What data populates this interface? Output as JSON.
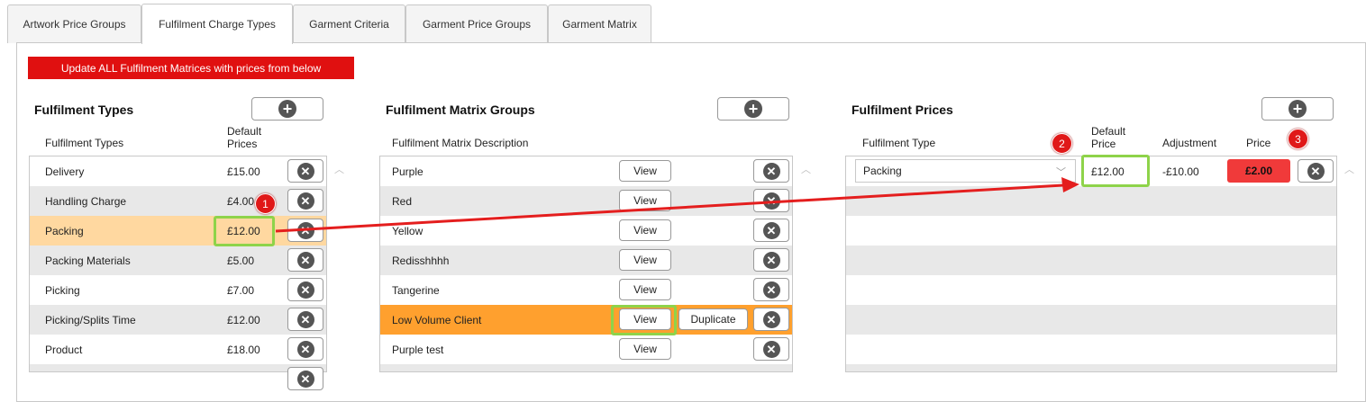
{
  "tabs": [
    {
      "label": "Artwork Price Groups"
    },
    {
      "label": "Fulfilment Charge Types"
    },
    {
      "label": "Garment Criteria"
    },
    {
      "label": "Garment Price Groups"
    },
    {
      "label": "Garment Matrix"
    }
  ],
  "update_all_label": "Update ALL Fulfilment Matrices with prices from below",
  "fulfilment_types": {
    "title": "Fulfilment Types",
    "col_name": "Fulfilment Types",
    "col_price_line1": "Default",
    "col_price_line2": "Prices",
    "rows": [
      {
        "name": "Delivery",
        "price": "£15.00"
      },
      {
        "name": "Handling Charge",
        "price": "£4.00"
      },
      {
        "name": "Packing",
        "price": "£12.00"
      },
      {
        "name": "Packing Materials",
        "price": "£5.00"
      },
      {
        "name": "Picking",
        "price": "£7.00"
      },
      {
        "name": "Picking/Splits Time",
        "price": "£12.00"
      },
      {
        "name": "Product",
        "price": "£18.00"
      }
    ]
  },
  "matrix_groups": {
    "title": "Fulfilment Matrix Groups",
    "col_desc": "Fulfilment Matrix Description",
    "view_label": "View",
    "duplicate_label": "Duplicate",
    "rows": [
      {
        "name": "Purple"
      },
      {
        "name": "Red"
      },
      {
        "name": "Yellow"
      },
      {
        "name": "Redisshhhh"
      },
      {
        "name": "Tangerine"
      },
      {
        "name": "Low Volume Client"
      },
      {
        "name": "Purple test"
      }
    ]
  },
  "fulfilment_prices": {
    "title": "Fulfilment Prices",
    "col_type": "Fulfilment Type",
    "col_default_line1": "Default",
    "col_default_line2": "Price",
    "col_adjustment": "Adjustment",
    "col_price": "Price",
    "row": {
      "type": "Packing",
      "default_price": "£12.00",
      "adjustment": "-£10.00",
      "price": "£2.00"
    }
  },
  "badges": {
    "b1": "1",
    "b2": "2",
    "b3": "3"
  },
  "colors": {
    "accent_red": "#e01010",
    "highlight_green": "#8ed34a",
    "row_orange": "#ffa02e",
    "row_peach": "#ffd8a0"
  }
}
